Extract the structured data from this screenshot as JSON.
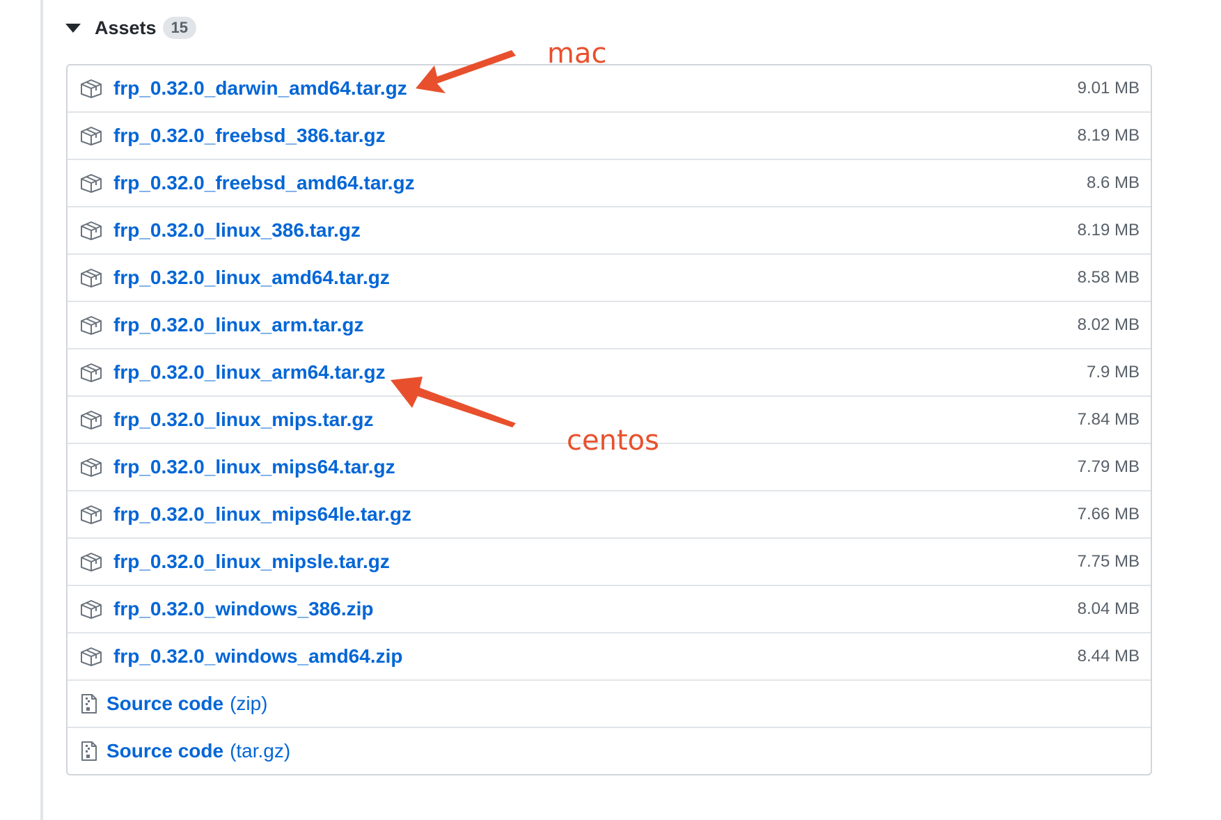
{
  "assets": {
    "title": "Assets",
    "count": "15",
    "files": [
      {
        "name": "frp_0.32.0_darwin_amd64.tar.gz",
        "size": "9.01 MB"
      },
      {
        "name": "frp_0.32.0_freebsd_386.tar.gz",
        "size": "8.19 MB"
      },
      {
        "name": "frp_0.32.0_freebsd_amd64.tar.gz",
        "size": "8.6 MB"
      },
      {
        "name": "frp_0.32.0_linux_386.tar.gz",
        "size": "8.19 MB"
      },
      {
        "name": "frp_0.32.0_linux_amd64.tar.gz",
        "size": "8.58 MB"
      },
      {
        "name": "frp_0.32.0_linux_arm.tar.gz",
        "size": "8.02 MB"
      },
      {
        "name": "frp_0.32.0_linux_arm64.tar.gz",
        "size": "7.9 MB"
      },
      {
        "name": "frp_0.32.0_linux_mips.tar.gz",
        "size": "7.84 MB"
      },
      {
        "name": "frp_0.32.0_linux_mips64.tar.gz",
        "size": "7.79 MB"
      },
      {
        "name": "frp_0.32.0_linux_mips64le.tar.gz",
        "size": "7.66 MB"
      },
      {
        "name": "frp_0.32.0_linux_mipsle.tar.gz",
        "size": "7.75 MB"
      },
      {
        "name": "frp_0.32.0_windows_386.zip",
        "size": "8.04 MB"
      },
      {
        "name": "frp_0.32.0_windows_amd64.zip",
        "size": "8.44 MB"
      }
    ],
    "source": [
      {
        "label": "Source code",
        "format": "(zip)"
      },
      {
        "label": "Source code",
        "format": "(tar.gz)"
      }
    ]
  },
  "annotations": {
    "mac_label": "mac",
    "centos_label": "centos",
    "color": "#e8502d"
  },
  "colors": {
    "link": "#0366d6",
    "muted": "#586069",
    "border": "#d1d5da"
  },
  "icons": {
    "file_row": "package-icon",
    "source_row": "file-zip-icon",
    "header": "triangle-down-icon"
  }
}
